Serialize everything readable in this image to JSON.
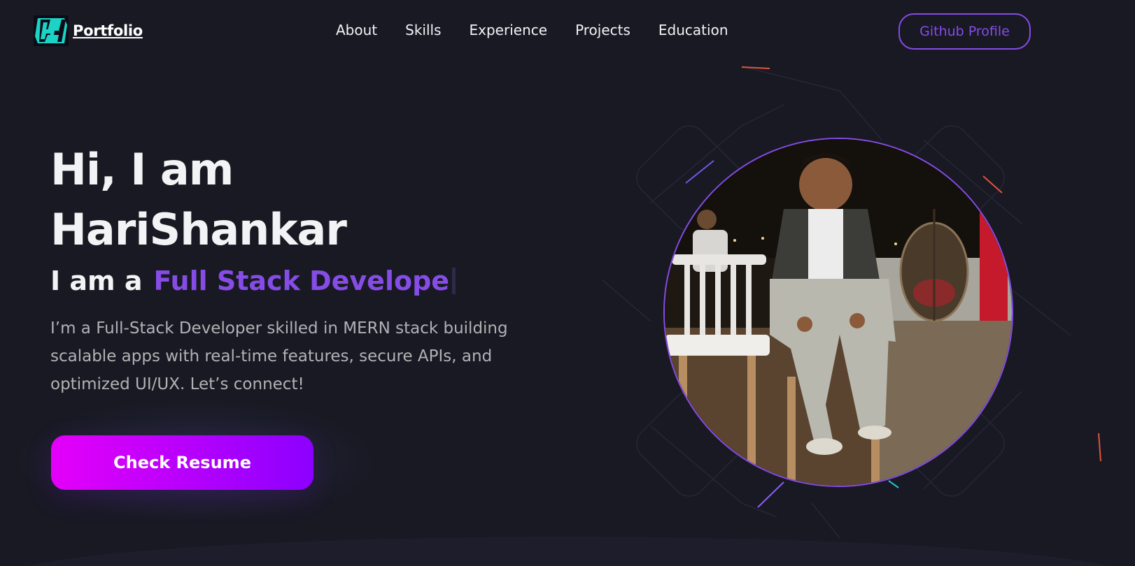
{
  "nav": {
    "logo_text": "Portfolio",
    "logo_icon": "hs-logo-icon",
    "links": [
      "About",
      "Skills",
      "Experience",
      "Projects",
      "Education"
    ],
    "github_button": "Github Profile"
  },
  "hero": {
    "greeting_line1": "Hi, I am",
    "greeting_line2": "HariShankar",
    "role_prefix": "I am a",
    "role_value": "Full Stack Develope",
    "description": "I’m a Full-Stack Developer skilled in MERN stack building scalable apps with real-time features, secure APIs, and optimized UI/UX. Let’s connect!",
    "resume_button": "Check Resume",
    "avatar_alt": "profile-photo"
  },
  "colors": {
    "background": "#191924",
    "accent": "#854ce6",
    "text_primary": "#f2f3f4",
    "text_secondary": "#b1b2b3",
    "button_gradient_start": "#e400f9",
    "button_gradient_end": "#8c00ff"
  }
}
